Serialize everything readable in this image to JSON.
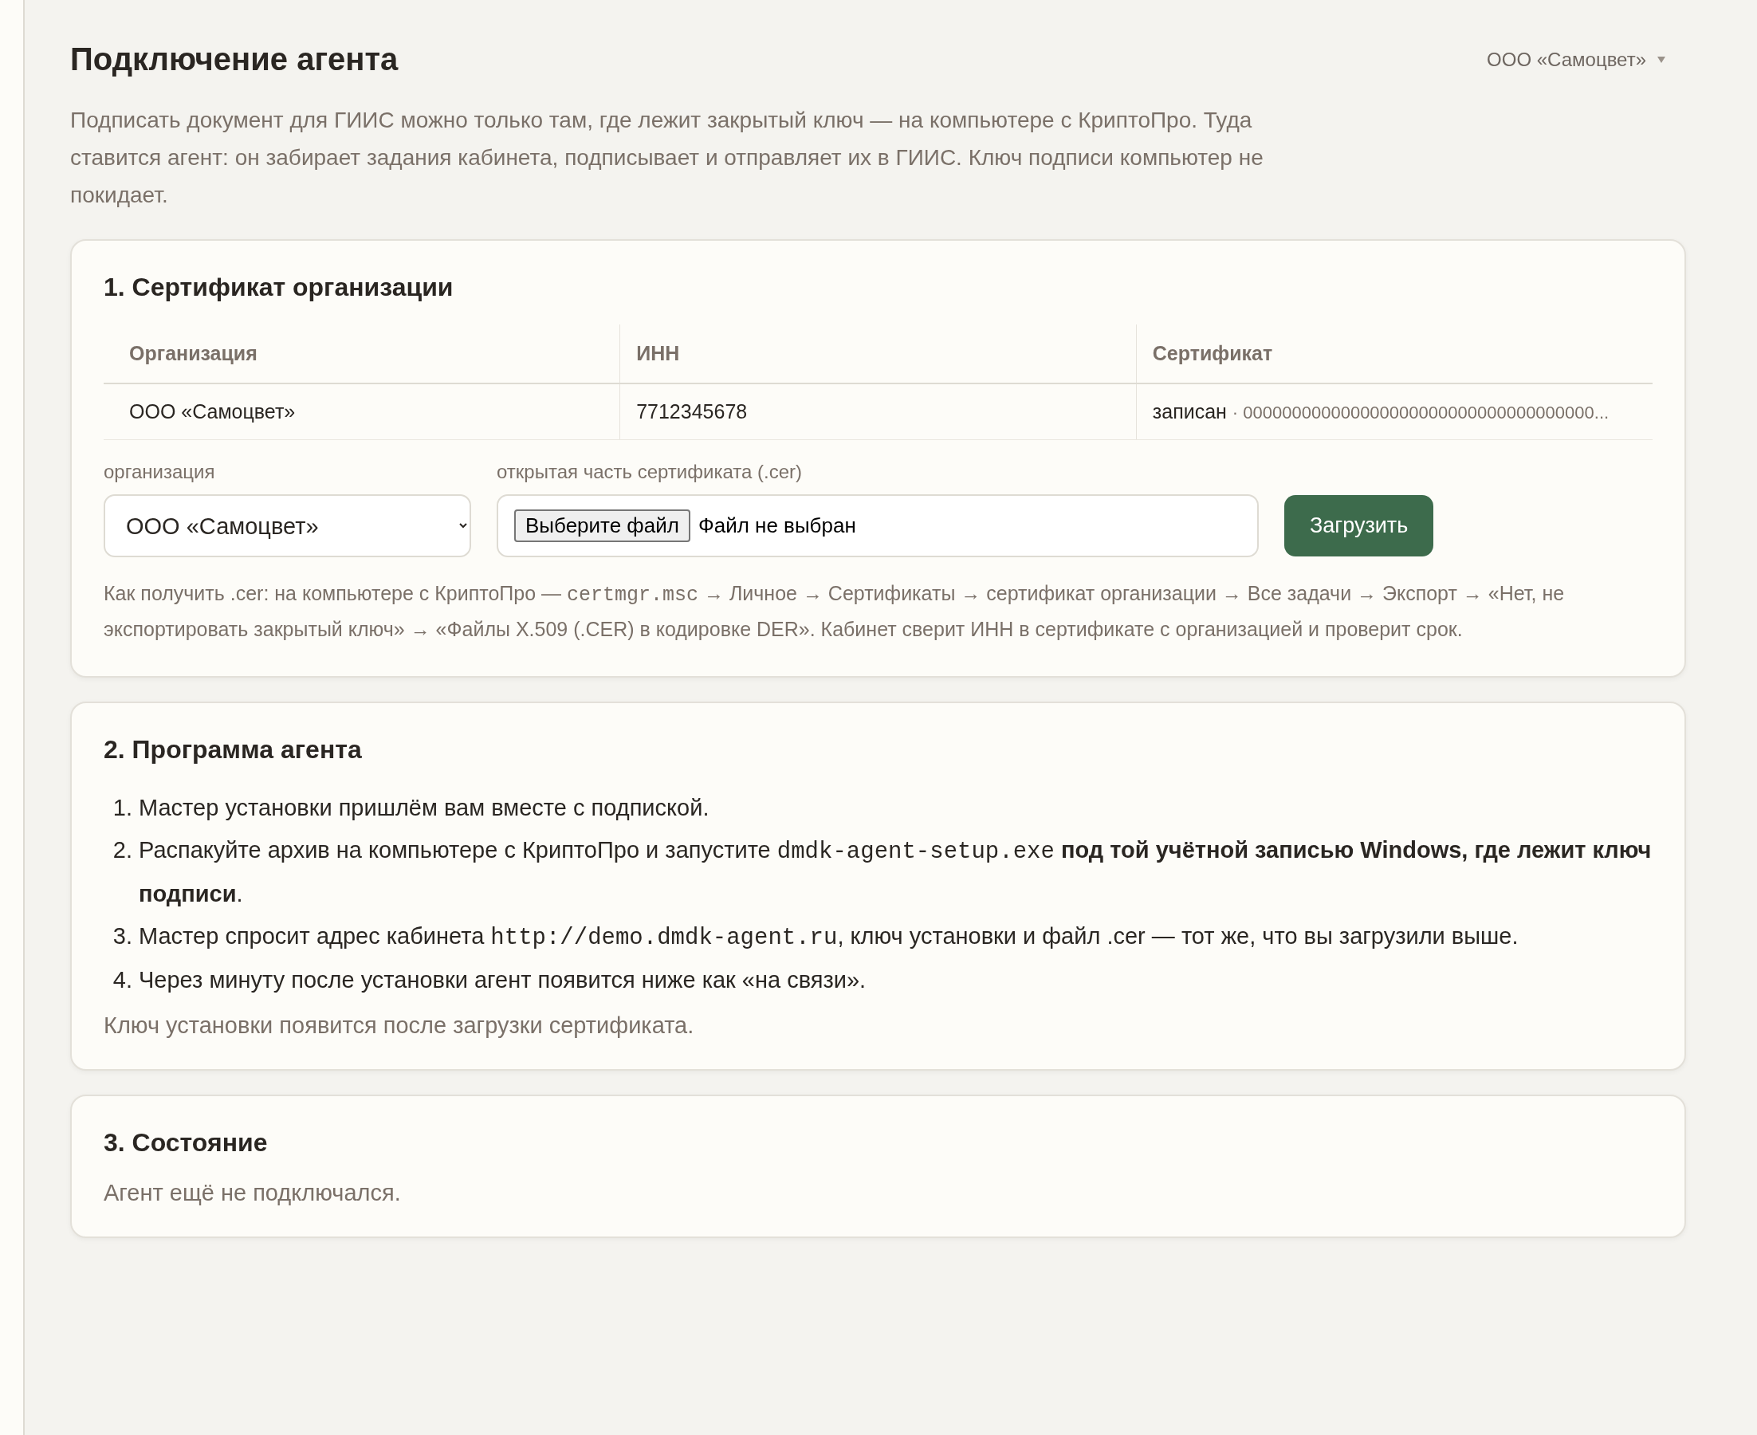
{
  "header": {
    "title": "Подключение агента",
    "org_switcher": "ООО «Самоцвет»"
  },
  "intro": "Подписать документ для ГИИС можно только там, где лежит закрытый ключ — на компьютере с КриптоПро. Туда ставится агент: он забирает задания кабинета, подписывает и отправляет их в ГИИС. Ключ подписи компьютер не покидает.",
  "certificate_card": {
    "title": "1. Сертификат организации",
    "table": {
      "columns": [
        "Организация",
        "ИНН",
        "Сертификат"
      ],
      "rows": [
        {
          "organization": "ООО «Самоцвет»",
          "inn": "7712345678",
          "certificate": {
            "status": "записан",
            "separator": "·",
            "value": "000000000000000000000000000000000000..."
          }
        }
      ]
    },
    "org_field": {
      "label": "организация",
      "value": "ООО «Самоцвет»"
    },
    "file_field": {
      "label": "открытая часть сертификата (.cer)",
      "button": "Выберите файл",
      "status": "Файл не выбран"
    },
    "upload_button": "Загрузить",
    "help": [
      {
        "kind": "text",
        "text": "Как получить .cer: на компьютере с КриптоПро — "
      },
      {
        "kind": "code",
        "text": "certmgr.msc"
      },
      {
        "kind": "text",
        "text": " → Личное → Сертификаты → сертификат организации → Все задачи → Экспорт → «Нет, не экспортировать закрытый ключ» → «Файлы X.509 (.CER) в кодировке DER». Кабинет сверит ИНН в сертификате с организацией и проверит срок."
      }
    ]
  },
  "agent_card": {
    "title": "2. Программа агента",
    "steps": [
      {
        "marker": "1.",
        "segments": [
          {
            "kind": "text",
            "text": "Мастер установки пришлём вам вместе с подпиской."
          }
        ]
      },
      {
        "marker": "2.",
        "segments": [
          {
            "kind": "text",
            "text": "Распакуйте архив на компьютере с КриптоПро и запустите "
          },
          {
            "kind": "code",
            "text": "dmdk-agent-setup.exe"
          },
          {
            "kind": "bold",
            "text": " под той учётной записью Windows, где лежит ключ подписи"
          },
          {
            "kind": "text",
            "text": "."
          }
        ]
      },
      {
        "marker": "3.",
        "segments": [
          {
            "kind": "text",
            "text": "Мастер спросит адрес кабинета "
          },
          {
            "kind": "code",
            "text": "http://demo.dmdk-agent.ru"
          },
          {
            "kind": "text",
            "text": ", ключ установки и файл .cer — тот же, что вы загрузили выше."
          }
        ]
      },
      {
        "marker": "4.",
        "segments": [
          {
            "kind": "text",
            "text": "Через минуту после установки агент появится ниже как «на связи»."
          }
        ]
      }
    ],
    "note": "Ключ установки появится после загрузки сертификата."
  },
  "status_card": {
    "title": "3. Состояние",
    "text": "Агент ещё не подключался."
  }
}
